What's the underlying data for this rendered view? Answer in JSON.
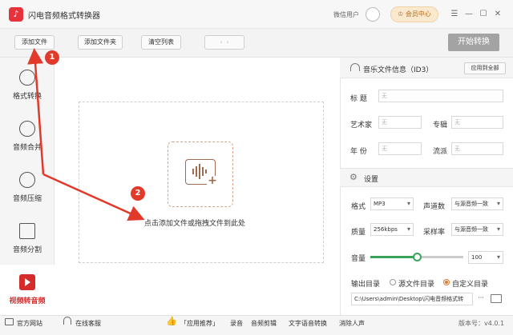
{
  "window": {
    "title": "闪电音频格式转换器",
    "user_label": "微信用户",
    "vip_label": "会员中心"
  },
  "toolbar": {
    "add_file": "添加文件",
    "add_folder": "添加文件夹",
    "clear_list": "清空列表",
    "start": "开始转换"
  },
  "sidebar": {
    "items": [
      {
        "label": "格式转换",
        "icon": "refresh-icon"
      },
      {
        "label": "音频合并",
        "icon": "merge-icon"
      },
      {
        "label": "音频压缩",
        "icon": "compress-icon"
      },
      {
        "label": "音频分割",
        "icon": "split-icon"
      },
      {
        "label": "视频转音频",
        "icon": "play-icon",
        "active": true
      }
    ]
  },
  "drop": {
    "text": "点击添加文件或拖拽文件到此处"
  },
  "id3": {
    "title": "音乐文件信息（ID3）",
    "apply_all": "应用到全部",
    "title_label": "标  题",
    "artist_label": "艺术家",
    "album_label": "专辑",
    "year_label": "年  份",
    "genre_label": "流派",
    "empty_value": "无"
  },
  "settings": {
    "title": "设置",
    "format_label": "格式",
    "format_value": "MP3",
    "channel_label": "声道数",
    "channel_value": "与源音频一致",
    "quality_label": "质量",
    "quality_value": "256kbps",
    "sample_label": "采样率",
    "sample_value": "与源音频一致",
    "volume_label": "音量",
    "volume_value": "100",
    "output_label": "输出目录",
    "source_dir_option": "源文件目录",
    "custom_dir_option": "自定义目录",
    "path_value": "C:\\Users\\admin\\Desktop\\闪电音频格式转",
    "more": "···"
  },
  "statusbar": {
    "website": "官方网站",
    "support": "在线客服",
    "recommend": "「应用推荐」",
    "record": "录音",
    "clip": "音频剪辑",
    "tts": "文字语音转换",
    "vocal": "消除人声",
    "version": "版本号：v4.0.1"
  },
  "annotations": {
    "step1": "1",
    "step2": "2"
  },
  "colors": {
    "accent": "#d62b2b",
    "slider": "#3aa35a",
    "annotation": "#e23a2a"
  }
}
